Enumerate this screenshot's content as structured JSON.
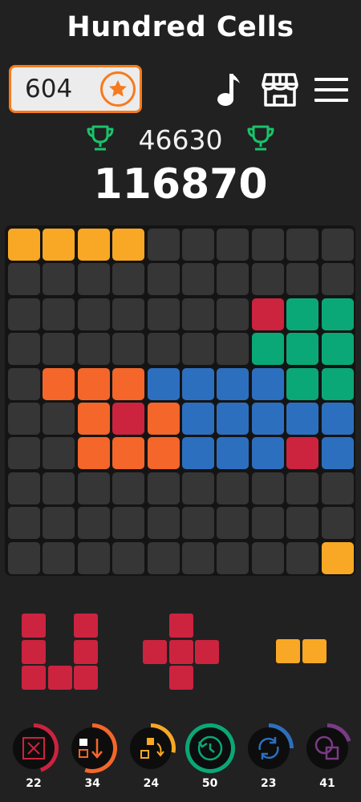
{
  "title": "Hundred Cells",
  "coins": {
    "value": "604",
    "icon": "star-coin-icon"
  },
  "toolbar": {
    "icons": [
      "music-note-icon",
      "shop-icon",
      "menu-icon"
    ]
  },
  "best_score": {
    "value": "46630",
    "icon": "trophy-icon"
  },
  "score": "116870",
  "colors": {
    "empty": "#363636",
    "yellow": "#f9a825",
    "orange": "#f4662a",
    "red": "#cc233f",
    "green": "#0aa876",
    "blue": "#2d6fbf",
    "purple": "#7b3a86"
  },
  "board": [
    "YYYY......",
    "..........",
    ".......RGG",
    ".......GGG",
    ".OOOBBBBGG",
    "..OROBBBBB",
    "..OOOBBBRB",
    "..........",
    "..........",
    ".........Y"
  ],
  "pieces": [
    {
      "name": "red-u-piece",
      "color": "red",
      "cells": [
        [
          0,
          0
        ],
        [
          2,
          0
        ],
        [
          0,
          1
        ],
        [
          2,
          1
        ],
        [
          0,
          2
        ],
        [
          1,
          2
        ],
        [
          2,
          2
        ]
      ]
    },
    {
      "name": "red-plus-piece",
      "color": "red",
      "cells": [
        [
          1,
          0
        ],
        [
          0,
          1
        ],
        [
          1,
          1
        ],
        [
          2,
          1
        ],
        [
          1,
          2
        ]
      ]
    },
    {
      "name": "yellow-domino-piece",
      "color": "yellow",
      "cells": [
        [
          0,
          0
        ],
        [
          1,
          0
        ]
      ]
    }
  ],
  "powerups": [
    {
      "name": "clear-cell",
      "icon": "clear-cell-icon",
      "count": "22",
      "color": "#cc233f",
      "fill": 0.45
    },
    {
      "name": "swap-order",
      "icon": "swap-order-icon",
      "count": "34",
      "color": "#f4662a",
      "fill": 0.55
    },
    {
      "name": "rotate",
      "icon": "rotate-icon",
      "count": "24",
      "color": "#f9a825",
      "fill": 0.28
    },
    {
      "name": "undo",
      "icon": "undo-icon",
      "count": "50",
      "color": "#0aa876",
      "fill": 1.0
    },
    {
      "name": "refresh",
      "icon": "refresh-icon",
      "count": "23",
      "color": "#2d6fbf",
      "fill": 0.25
    },
    {
      "name": "shapes",
      "icon": "shapes-icon",
      "count": "41",
      "color": "#7b3a86",
      "fill": 0.2
    }
  ]
}
